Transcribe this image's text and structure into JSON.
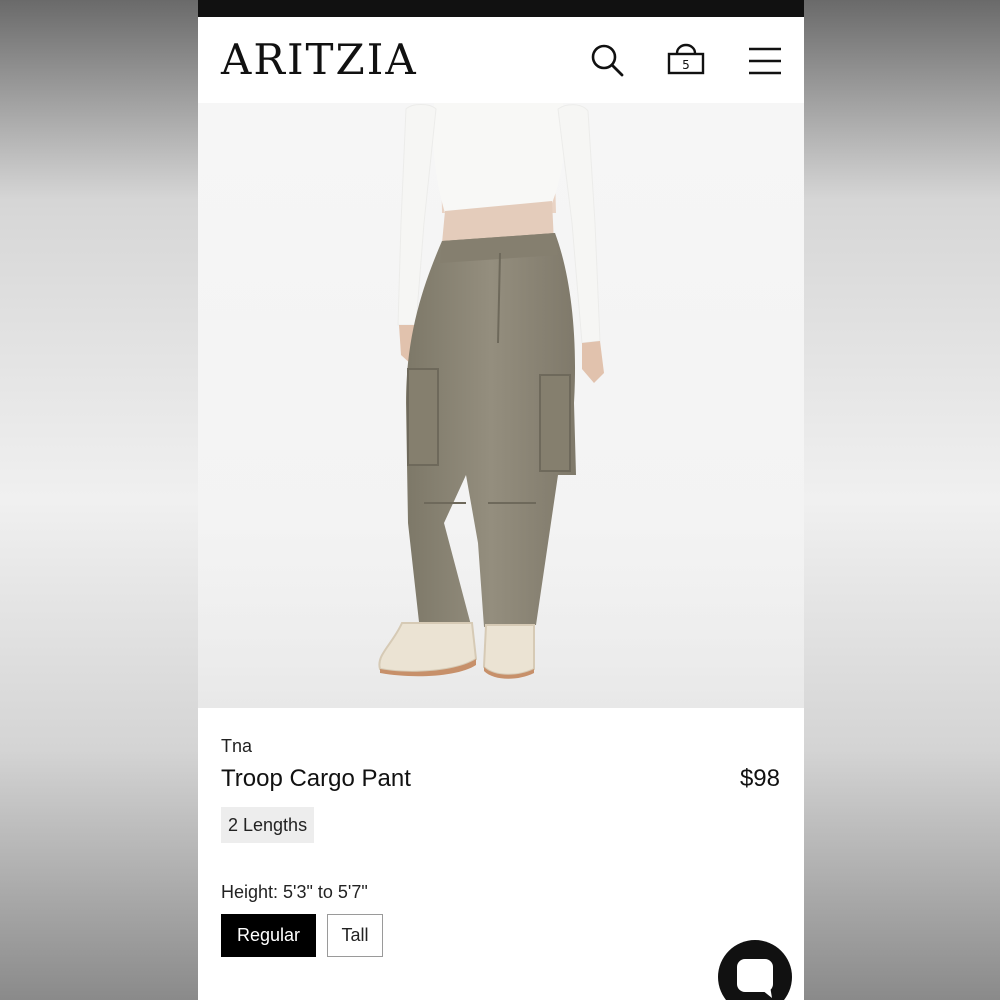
{
  "header": {
    "logo_text": "ARITZIA",
    "bag_count": "5",
    "icons": [
      "search-icon",
      "shopping-bag-icon",
      "menu-icon"
    ]
  },
  "product": {
    "brand": "Tna",
    "name": "Troop Cargo Pant",
    "price": "$98",
    "lengths_badge": "2 Lengths",
    "height_label": "Height: 5'3\" to 5'7\"",
    "length_options": [
      "Regular",
      "Tall"
    ],
    "selected_length": "Regular",
    "image": "model-wearing-khaki-cargo-pants"
  },
  "colors": {
    "pants": "#8c8676",
    "top": "#f7f7f5",
    "selected_button": "#000000",
    "status_bar": "#111111"
  }
}
